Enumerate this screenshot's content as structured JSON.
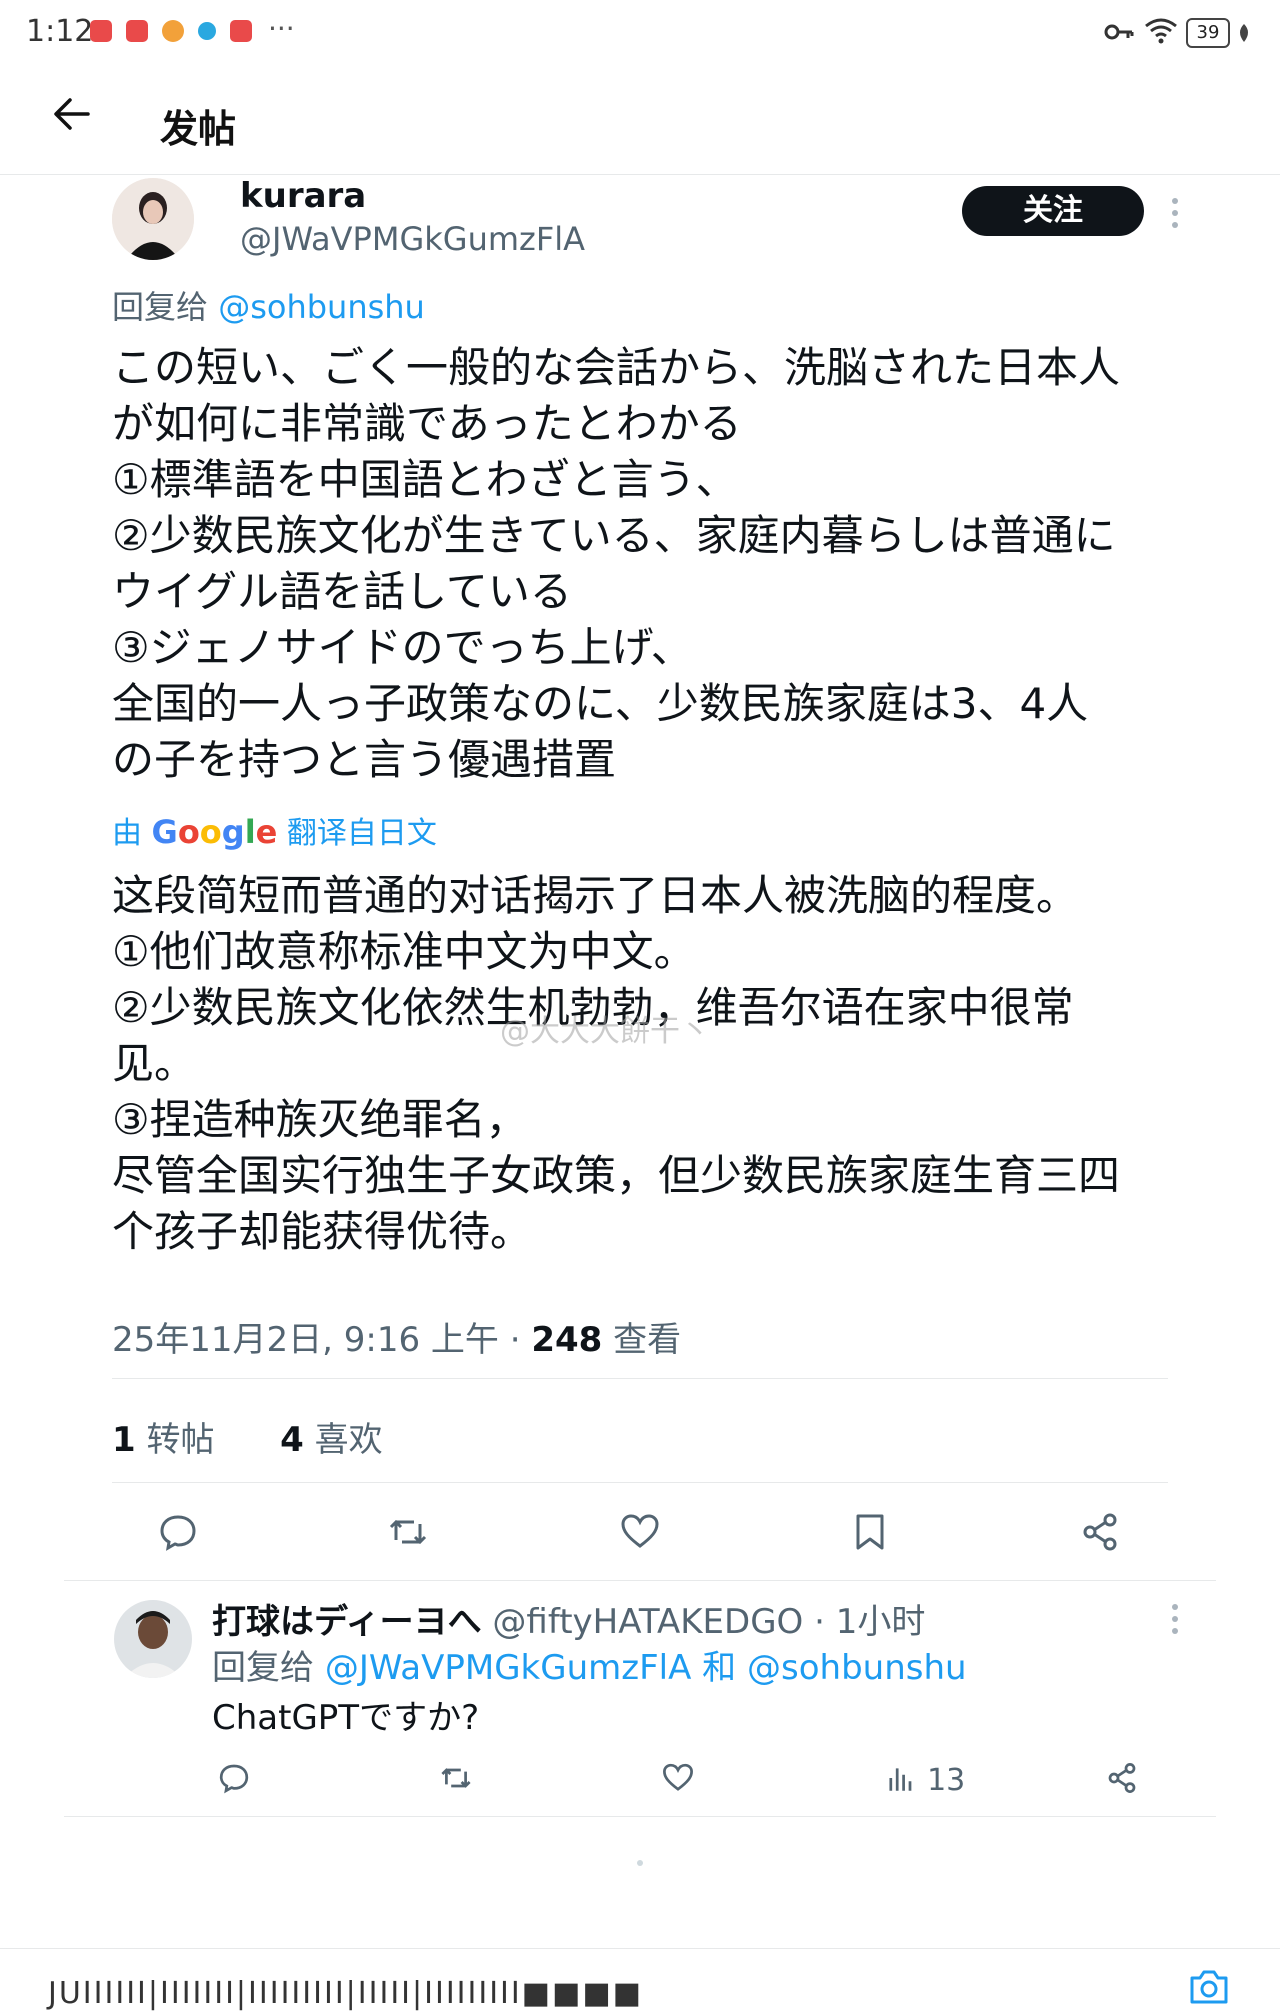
{
  "status_bar": {
    "time": "1:12",
    "battery": "39"
  },
  "header": {
    "title": "发帖"
  },
  "tweet": {
    "author_name": "kurara",
    "author_handle": "@JWaVPMGkGumzFlA",
    "follow_label": "关注",
    "reply_prefix": "回复给",
    "reply_to": "@sohbunshu",
    "original_text": "この短い、ごく一般的な会話から、洗脳された日本人\nが如何に非常識であったとわかる\n①標準語を中国語とわざと言う、\n②少数民族文化が生きている、家庭内暮らしは普通に\nウイグル語を話している\n③ジェノサイドのでっち上げ、\n全国的一人っ子政策なのに、少数民族家庭は3、4人\nの子を持つと言う優遇措置",
    "translate_prefix": "由",
    "translate_suffix": "翻译自日文",
    "translated_text": "这段简短而普通的对话揭示了日本人被洗脑的程度。\n①他们故意称标准中文为中文。\n②少数民族文化依然生机勃勃，维吾尔语在家中很常\n见。\n③捏造种族灭绝罪名，\n尽管全国实行独生子女政策，但少数民族家庭生育三四\n个孩子却能获得优待。",
    "timestamp": "25年11月2日, 9:16 上午 · ",
    "views_count": "248",
    "views_label": " 查看",
    "retweets_count": "1",
    "retweets_label": " 转帖",
    "likes_count": "4",
    "likes_label": " 喜欢"
  },
  "reply": {
    "author_name": "打球はディーヨへ",
    "author_handle": " @fiftyHATAKEDGO · 1小时",
    "reply_prefix": "回复给 ",
    "reply_to_1": "@JWaVPMGkGumzFlA",
    "reply_and": " 和 ",
    "reply_to_2": "@sohbunshu",
    "text": "ChatGPTですか?",
    "views": "13"
  },
  "watermark": "@大大大餅干丶",
  "bottom": {
    "compose_text": "JUIIIIII|IIIIIII|IIIIIIIII|IIIII|IIIIIIIII■■■■"
  },
  "colors": {
    "accent": "#1d9bf0",
    "text": "#0f1419",
    "muted": "#536471",
    "divider": "#e7e9ea"
  },
  "icons": [
    "back-arrow-icon",
    "reply-icon",
    "retweet-icon",
    "like-icon",
    "bookmark-icon",
    "share-icon",
    "views-icon",
    "more-icon",
    "camera-icon",
    "key-icon",
    "wifi-icon"
  ]
}
